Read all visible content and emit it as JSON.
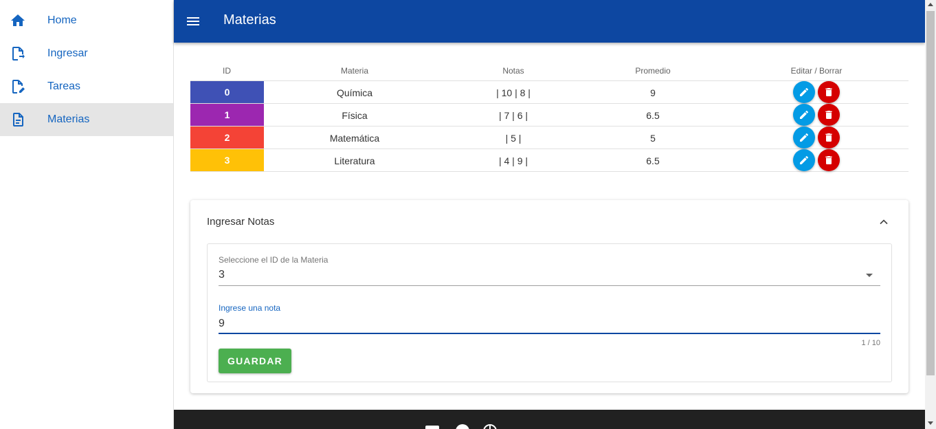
{
  "sidebar": {
    "items": [
      {
        "label": "Home",
        "icon": "home-icon"
      },
      {
        "label": "Ingresar",
        "icon": "file-import-icon"
      },
      {
        "label": "Tareas",
        "icon": "file-edit-icon"
      },
      {
        "label": "Materias",
        "icon": "file-document-icon",
        "active": true
      }
    ]
  },
  "header": {
    "title": "Materias",
    "menu_icon": "menu-icon"
  },
  "table": {
    "headers": [
      "ID",
      "Materia",
      "Notas",
      "Promedio",
      "Editar / Borrar"
    ],
    "rows": [
      {
        "id": "0",
        "materia": "Química",
        "notas": "| 10 | 8 |",
        "promedio": "9",
        "color": "#3f51b5"
      },
      {
        "id": "1",
        "materia": "Física",
        "notas": "| 7 | 6 |",
        "promedio": "6.5",
        "color": "#9c27b0"
      },
      {
        "id": "2",
        "materia": "Matemática",
        "notas": "| 5 |",
        "promedio": "5",
        "color": "#f44336"
      },
      {
        "id": "3",
        "materia": "Literatura",
        "notas": "| 4 | 9 |",
        "promedio": "6.5",
        "color": "#ffc107"
      }
    ]
  },
  "form": {
    "title": "Ingresar Notas",
    "select_label": "Seleccione el ID de la Materia",
    "select_value": "3",
    "input_label": "Ingrese una nota",
    "input_value": "9",
    "counter": "1 / 10",
    "save_label": "GUARDAR"
  },
  "colors": {
    "appbar": "#0d47a1",
    "nav_text": "#1565c0",
    "edit": "#039be5",
    "delete": "#d50000",
    "save": "#4caf50",
    "footer": "#212121"
  }
}
